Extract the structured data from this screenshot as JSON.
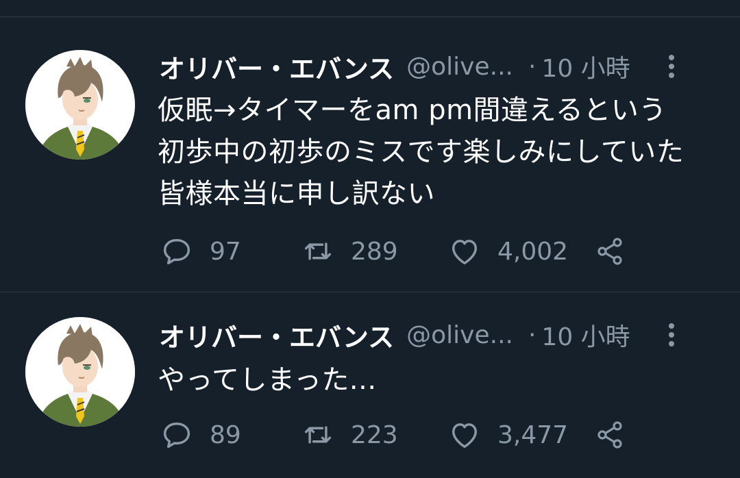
{
  "colors": {
    "background": "#15202b",
    "divider": "#2f3b47",
    "primary_text": "#ffffff",
    "secondary_text": "#8b98a5"
  },
  "tweets": [
    {
      "display_name": "オリバー・エバンス",
      "handle": "@olive...",
      "separator": "·",
      "time": "10 小時",
      "body_lines": [
        "仮眠→タイマーをam pm間違えるという",
        "初歩中の初歩のミスです楽しみにしていた",
        "皆様本当に申し訳ない"
      ],
      "reply_count": "97",
      "retweet_count": "289",
      "like_count": "4,002"
    },
    {
      "display_name": "オリバー・エバンス",
      "handle": "@olive...",
      "separator": "·",
      "time": "10 小時",
      "body_lines": [
        "やってしまった..."
      ],
      "reply_count": "89",
      "retweet_count": "223",
      "like_count": "3,477"
    }
  ],
  "icons": {
    "reply": "reply-bubble-icon",
    "retweet": "retweet-icon",
    "like": "heart-icon",
    "share": "share-icon",
    "more": "more-vertical-icon"
  }
}
